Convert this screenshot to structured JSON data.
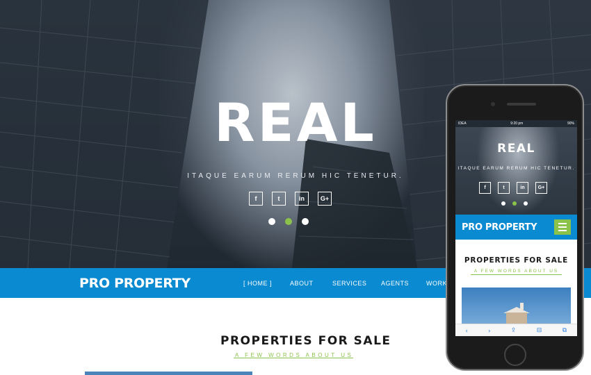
{
  "hero": {
    "title": "REAL",
    "subtitle": "ITAQUE EARUM RERUM HIC TENETUR.",
    "social": [
      {
        "label": "f",
        "icon": "facebook-icon"
      },
      {
        "label": "t",
        "icon": "twitter-icon"
      },
      {
        "label": "in",
        "icon": "linkedin-icon"
      },
      {
        "label": "G+",
        "icon": "google-plus-icon"
      }
    ],
    "slides": {
      "count": 3,
      "active": 2
    }
  },
  "navbar": {
    "brand": "PRO PROPERTY",
    "items": [
      "[ HOME ]",
      "ABOUT",
      "SERVICES",
      "AGENTS",
      "WORKS"
    ],
    "active": "HOME"
  },
  "section": {
    "title": "PROPERTIES FOR SALE",
    "subtitle": "A FEW WORDS ABOUT US"
  },
  "mobile": {
    "status": {
      "carrier": "IDEA",
      "time": "9:20 pm",
      "battery": "90%"
    },
    "title": "REAL",
    "subtitle": "ITAQUE EARUM RERUM HIC TENETUR.",
    "social": [
      "f",
      "t",
      "in",
      "G+"
    ],
    "brand": "PRO PROPERTY",
    "section_title": "PROPERTIES FOR SALE",
    "section_subtitle": "A FEW WORDS ABOUT US",
    "toolbar": [
      "‹",
      "›",
      "⇪",
      "⊟",
      "⧉"
    ]
  },
  "colors": {
    "nav_blue": "#0a8ad0",
    "accent_green": "#8bc34a",
    "hero_dark": "#2b3540"
  }
}
